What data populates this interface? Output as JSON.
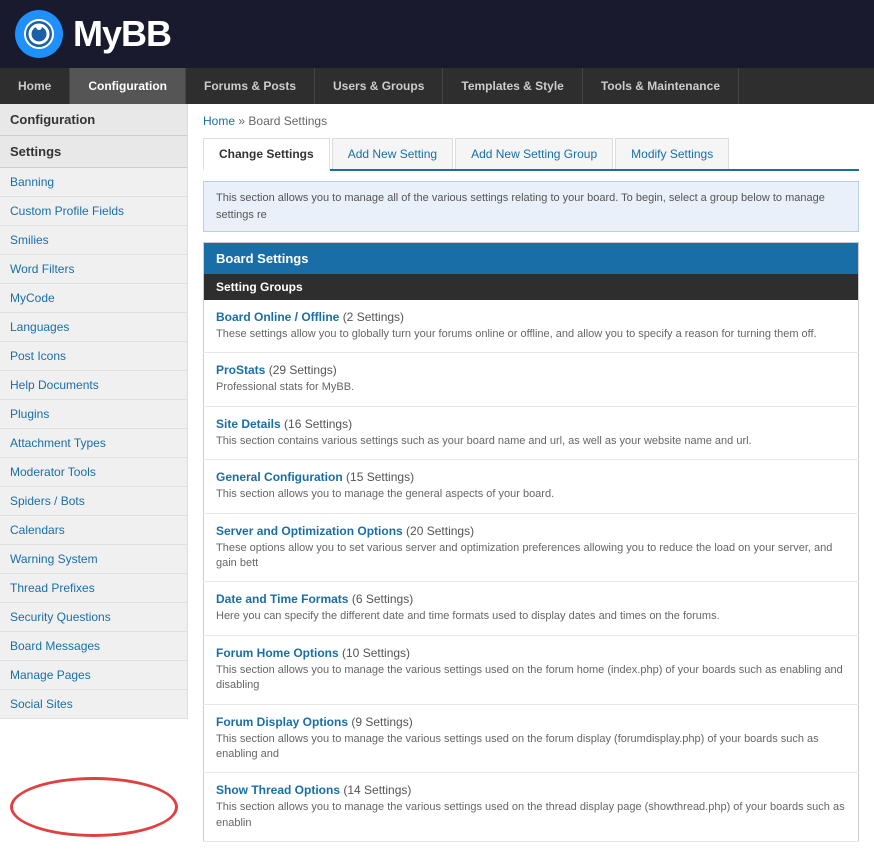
{
  "header": {
    "logo_text": "MyBB",
    "logo_alt": "MyBB Logo"
  },
  "nav": {
    "items": [
      {
        "id": "home",
        "label": "Home",
        "active": false
      },
      {
        "id": "configuration",
        "label": "Configuration",
        "active": true
      },
      {
        "id": "forums-posts",
        "label": "Forums & Posts",
        "active": false
      },
      {
        "id": "users-groups",
        "label": "Users & Groups",
        "active": false
      },
      {
        "id": "templates-style",
        "label": "Templates & Style",
        "active": false
      },
      {
        "id": "tools-maintenance",
        "label": "Tools & Maintenance",
        "active": false
      }
    ]
  },
  "sidebar": {
    "section_title": "Configuration",
    "settings_title": "Settings",
    "items": [
      {
        "id": "banning",
        "label": "Banning"
      },
      {
        "id": "custom-profile-fields",
        "label": "Custom Profile Fields"
      },
      {
        "id": "smilies",
        "label": "Smilies"
      },
      {
        "id": "word-filters",
        "label": "Word Filters"
      },
      {
        "id": "mycode",
        "label": "MyCode"
      },
      {
        "id": "languages",
        "label": "Languages"
      },
      {
        "id": "post-icons",
        "label": "Post Icons"
      },
      {
        "id": "help-documents",
        "label": "Help Documents"
      },
      {
        "id": "plugins",
        "label": "Plugins"
      },
      {
        "id": "attachment-types",
        "label": "Attachment Types"
      },
      {
        "id": "moderator-tools",
        "label": "Moderator Tools"
      },
      {
        "id": "spiders-bots",
        "label": "Spiders / Bots"
      },
      {
        "id": "calendars",
        "label": "Calendars"
      },
      {
        "id": "warning-system",
        "label": "Warning System"
      },
      {
        "id": "thread-prefixes",
        "label": "Thread Prefixes"
      },
      {
        "id": "security-questions",
        "label": "Security Questions"
      },
      {
        "id": "board-messages",
        "label": "Board Messages"
      },
      {
        "id": "manage-pages",
        "label": "Manage Pages"
      },
      {
        "id": "social-sites",
        "label": "Social Sites"
      }
    ]
  },
  "breadcrumb": {
    "home": "Home",
    "separator": "»",
    "current": "Board Settings"
  },
  "tabs": [
    {
      "id": "change-settings",
      "label": "Change Settings",
      "active": true
    },
    {
      "id": "add-new-setting",
      "label": "Add New Setting",
      "active": false
    },
    {
      "id": "add-new-setting-group",
      "label": "Add New Setting Group",
      "active": false
    },
    {
      "id": "modify-settings",
      "label": "Modify Settings",
      "active": false
    }
  ],
  "info_text": "This section allows you to manage all of the various settings relating to your board. To begin, select a group below to manage settings re",
  "settings_panel": {
    "title": "Board Settings",
    "subheader": "Setting Groups",
    "groups": [
      {
        "id": "board-online-offline",
        "name": "Board Online / Offline",
        "count": "(2 Settings)",
        "description": "These settings allow you to globally turn your forums online or offline, and allow you to specify a reason for turning them off."
      },
      {
        "id": "prostats",
        "name": "ProStats",
        "count": "(29 Settings)",
        "description": "Professional stats for MyBB."
      },
      {
        "id": "site-details",
        "name": "Site Details",
        "count": "(16 Settings)",
        "description": "This section contains various settings such as your board name and url, as well as your website name and url."
      },
      {
        "id": "general-configuration",
        "name": "General Configuration",
        "count": "(15 Settings)",
        "description": "This section allows you to manage the general aspects of your board."
      },
      {
        "id": "server-optimization",
        "name": "Server and Optimization Options",
        "count": "(20 Settings)",
        "description": "These options allow you to set various server and optimization preferences allowing you to reduce the load on your server, and gain bett"
      },
      {
        "id": "date-time-formats",
        "name": "Date and Time Formats",
        "count": "(6 Settings)",
        "description": "Here you can specify the different date and time formats used to display dates and times on the forums."
      },
      {
        "id": "forum-home-options",
        "name": "Forum Home Options",
        "count": "(10 Settings)",
        "description": "This section allows you to manage the various settings used on the forum home (index.php) of your boards such as enabling and disabling"
      },
      {
        "id": "forum-display-options",
        "name": "Forum Display Options",
        "count": "(9 Settings)",
        "description": "This section allows you to manage the various settings used on the forum display (forumdisplay.php) of your boards such as enabling and"
      },
      {
        "id": "show-thread-options",
        "name": "Show Thread Options",
        "count": "(14 Settings)",
        "description": "This section allows you to manage the various settings used on the thread display page (showthread.php) of your boards such as enablin"
      }
    ]
  }
}
